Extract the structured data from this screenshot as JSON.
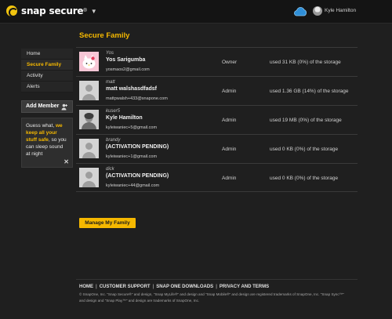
{
  "brand": {
    "name": "snap secure",
    "reg": "®",
    "accent": "#f5b800"
  },
  "header": {
    "user_name": "Kyle Hamilton"
  },
  "sidebar": {
    "items": [
      {
        "label": "Home",
        "active": false
      },
      {
        "label": "Secure Family",
        "active": true
      },
      {
        "label": "Activity",
        "active": false
      },
      {
        "label": "Alerts",
        "active": false
      }
    ],
    "add_member_label": "Add Member",
    "tip": {
      "part1": "Guess what, ",
      "highlight": "we keep all your stuff safe",
      "part2": ", so you can sleep sound at night"
    }
  },
  "main": {
    "title": "Secure Family",
    "members": [
      {
        "alias": "Yos",
        "name": "Yos Sarigumba",
        "email": "yosmaos2@gmail.com",
        "role": "Owner",
        "storage": "used 31 KB (0%) of the storage",
        "avatar": "kitty-icon"
      },
      {
        "alias": "matt",
        "name": "matt walshasdfadsf",
        "email": "mattpwalsh+433@snapone.com",
        "role": "Admin",
        "storage": "used 1.36 GB (14%) of the storage",
        "avatar": "default-avatar-icon"
      },
      {
        "alias": "kuser5",
        "name": "Kyle Hamilton",
        "email": "kyleiwaniec+5@gmail.com",
        "role": "Admin",
        "storage": "used 19 MB (0%) of the storage",
        "avatar": "photo-avatar"
      },
      {
        "alias": "brandy",
        "name": "(ACTIVATION PENDING)",
        "email": "kyleiwaniec+1@gmail.com",
        "role": "Admin",
        "storage": "used 0 KB (0%) of the storage",
        "avatar": "default-avatar-icon"
      },
      {
        "alias": "dick",
        "name": "(ACTIVATION PENDING)",
        "email": "kyleiwaniec+44@gmail.com",
        "role": "Admin",
        "storage": "used 0 KB (0%) of the storage",
        "avatar": "default-avatar-icon"
      }
    ],
    "manage_button": "Manage My Family"
  },
  "footer": {
    "links": [
      "HOME",
      "CUSTOMER SUPPORT",
      "SNAP ONE DOWNLOADS",
      "PRIVACY AND TERMS"
    ],
    "legal_line1": "© SnapOne, Inc. \"Snap Secure®\" and design, \"Snap MyLife®\" and design and \"Snap Mobile®\" and design are registered trademarks of SnapOne, Inc. \"Snap Sync™\"",
    "legal_line2": "and design and \"Snap Play™\" and design are trademarks of SnapOne, Inc."
  }
}
